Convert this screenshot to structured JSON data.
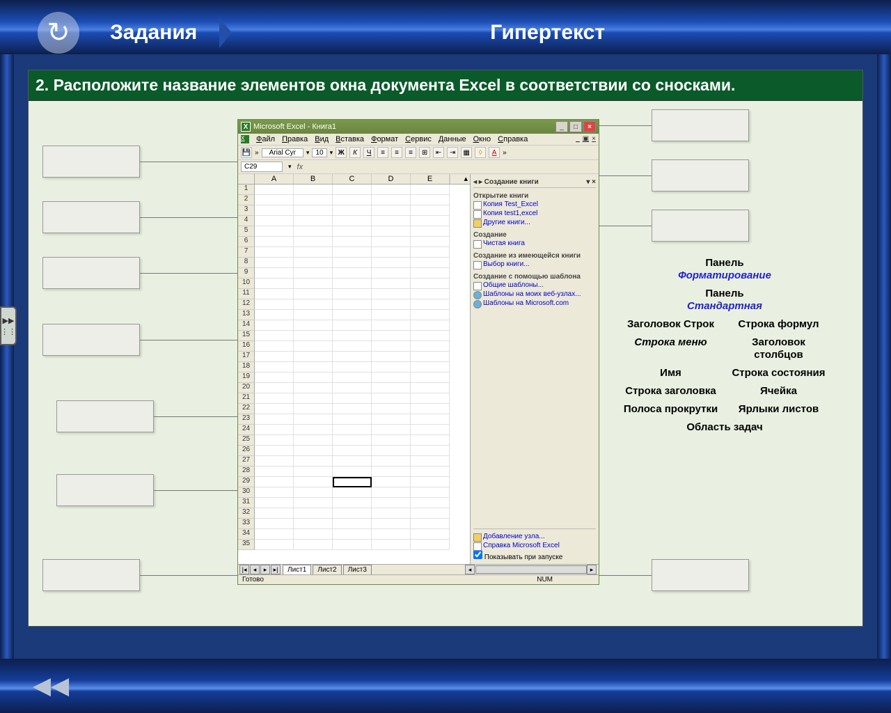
{
  "header": {
    "tab_left": "Задания",
    "tab_center": "Гипертекст"
  },
  "question": "2. Расположите название элементов окна документа Excel в соответствии со сносками.",
  "excel": {
    "title": "Microsoft Excel - Книга1",
    "menu": [
      "Файл",
      "Правка",
      "Вид",
      "Вставка",
      "Формат",
      "Сервис",
      "Данные",
      "Окно",
      "Справка"
    ],
    "font": "Arial Cyr",
    "font_size": "10",
    "name_box": "C29",
    "columns": [
      "A",
      "B",
      "C",
      "D",
      "E"
    ],
    "row_count": 35,
    "active_row": 29,
    "active_col": 2,
    "sheets": [
      "Лист1",
      "Лист2",
      "Лист3"
    ],
    "status_left": "Готово",
    "status_num": "NUM",
    "taskpane": {
      "title": "Создание книги",
      "sec1": "Открытие книги",
      "links1": [
        "Копия Test_Excel",
        "Копия test1,excel"
      ],
      "more1": "Другие книги...",
      "sec2": "Создание",
      "link2": "Чистая книга",
      "sec3": "Создание из имеющейся книги",
      "link3": "Выбор книги...",
      "sec4": "Создание с помощью шаблона",
      "links4": [
        "Общие шаблоны...",
        "Шаблоны на моих веб-узлах...",
        "Шаблоны на Microsoft.com"
      ],
      "footer1": "Добавление узла...",
      "footer2": "Справка Microsoft Excel",
      "footer3": "Показывать при запуске"
    }
  },
  "labels": {
    "panel_fmt_a": "Панель",
    "panel_fmt_b": "Форматирование",
    "panel_std_a": "Панель",
    "panel_std_b": "Стандартная",
    "row_header": "Заголовок Строк",
    "formula_bar": "Строка формул",
    "menu_bar": "Строка меню",
    "col_header": "Заголовок столбцов",
    "name": "Имя",
    "status_bar": "Строка состояния",
    "title_bar": "Строка заголовка",
    "cell": "Ячейка",
    "scrollbar": "Полоса прокрутки",
    "sheet_tabs": "Ярлыки листов",
    "task_area": "Область задач"
  },
  "nav": {
    "back": "◀◀",
    "reload": "↻",
    "expand": "▶▶"
  }
}
